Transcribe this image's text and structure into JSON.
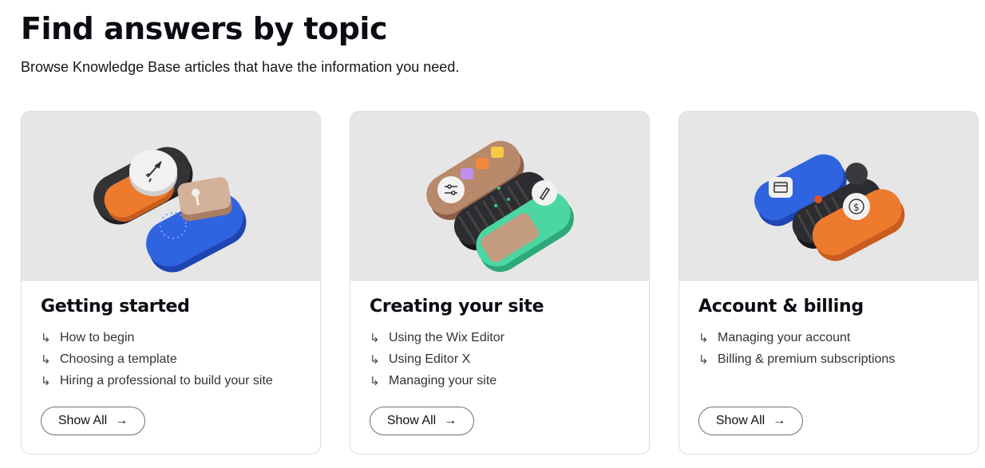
{
  "header": {
    "title": "Find answers by topic",
    "subtitle": "Browse Knowledge Base articles that have the information you need."
  },
  "cards": [
    {
      "title": "Getting started",
      "links": [
        "How to begin",
        "Choosing a template",
        "Hiring a professional to build your site"
      ],
      "button_label": "Show All",
      "image_icon": "rocket-icon"
    },
    {
      "title": "Creating your site",
      "links": [
        "Using the Wix Editor",
        "Using Editor X",
        "Managing your site"
      ],
      "button_label": "Show All",
      "image_icon": "editor-tools-icon"
    },
    {
      "title": "Account & billing",
      "links": [
        "Managing your account",
        "Billing & premium subscriptions"
      ],
      "button_label": "Show All",
      "image_icon": "dollar-icon"
    }
  ],
  "link_arrow_icon": "subdirectory-arrow-icon",
  "button_arrow_icon": "arrow-right-icon",
  "colors": {
    "image_background": "#e6e6e7",
    "orange": "#ee7a2e",
    "blue": "#2f63e0",
    "dark": "#2a2a2d",
    "tan": "#c9a58b",
    "green": "#4bd6a2"
  }
}
